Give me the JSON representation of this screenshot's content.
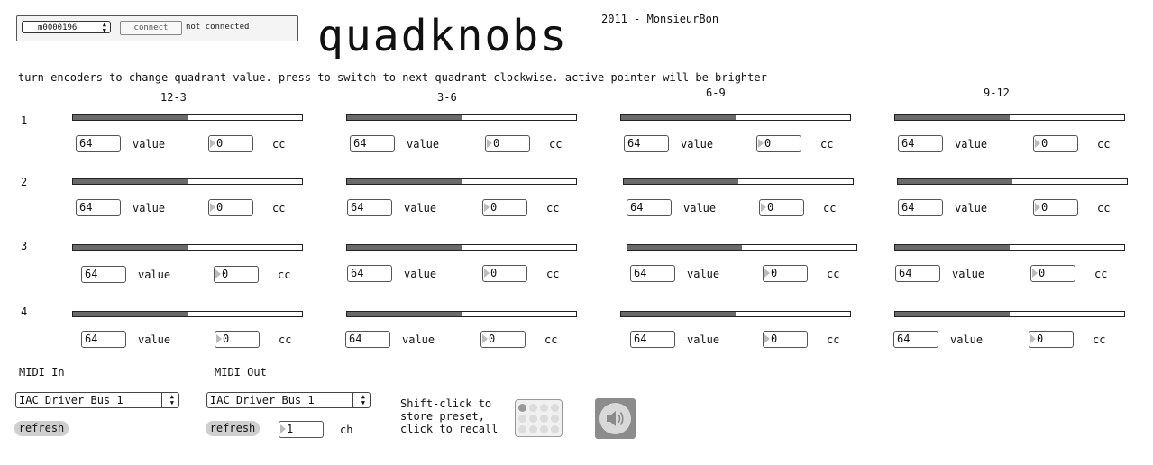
{
  "device": {
    "selected": "m0000196",
    "connect_label": "connect",
    "status": "not connected"
  },
  "title": "quadknobs",
  "credit": "2011 - MonsieurBon",
  "instructions": "turn encoders to change quadrant value. press to switch to next quadrant clockwise. active pointer will be brighter",
  "quadrants": [
    "12-3",
    "3-6",
    "6-9",
    "9-12"
  ],
  "rows": [
    {
      "label": "1",
      "cells": [
        {
          "slider": 0.5,
          "value": "64",
          "value_label": "value",
          "cc": "0",
          "cc_label": "cc"
        },
        {
          "slider": 0.5,
          "value": "64",
          "value_label": "value",
          "cc": "0",
          "cc_label": "cc"
        },
        {
          "slider": 0.5,
          "value": "64",
          "value_label": "value",
          "cc": "0",
          "cc_label": "cc"
        },
        {
          "slider": 0.5,
          "value": "64",
          "value_label": "value",
          "cc": "0",
          "cc_label": "cc"
        }
      ]
    },
    {
      "label": "2",
      "cells": [
        {
          "slider": 0.5,
          "value": "64",
          "value_label": "value",
          "cc": "0",
          "cc_label": "cc"
        },
        {
          "slider": 0.5,
          "value": "64",
          "value_label": "value",
          "cc": "0",
          "cc_label": "cc"
        },
        {
          "slider": 0.5,
          "value": "64",
          "value_label": "value",
          "cc": "0",
          "cc_label": "cc"
        },
        {
          "slider": 0.5,
          "value": "64",
          "value_label": "value",
          "cc": "0",
          "cc_label": "cc"
        }
      ]
    },
    {
      "label": "3",
      "cells": [
        {
          "slider": 0.5,
          "value": "64",
          "value_label": "value",
          "cc": "0",
          "cc_label": "cc"
        },
        {
          "slider": 0.5,
          "value": "64",
          "value_label": "value",
          "cc": "0",
          "cc_label": "cc"
        },
        {
          "slider": 0.5,
          "value": "64",
          "value_label": "value",
          "cc": "0",
          "cc_label": "cc"
        },
        {
          "slider": 0.5,
          "value": "64",
          "value_label": "value",
          "cc": "0",
          "cc_label": "cc"
        }
      ]
    },
    {
      "label": "4",
      "cells": [
        {
          "slider": 0.5,
          "value": "64",
          "value_label": "value",
          "cc": "0",
          "cc_label": "cc"
        },
        {
          "slider": 0.5,
          "value": "64",
          "value_label": "value",
          "cc": "0",
          "cc_label": "cc"
        },
        {
          "slider": 0.5,
          "value": "64",
          "value_label": "value",
          "cc": "0",
          "cc_label": "cc"
        },
        {
          "slider": 0.5,
          "value": "64",
          "value_label": "value",
          "cc": "0",
          "cc_label": "cc"
        }
      ]
    }
  ],
  "midi_in": {
    "label": "MIDI In",
    "selected": "IAC Driver Bus 1",
    "refresh_label": "refresh"
  },
  "midi_out": {
    "label": "MIDI Out",
    "selected": "IAC Driver Bus 1",
    "refresh_label": "refresh",
    "channel": "1",
    "channel_label": "ch"
  },
  "preset": {
    "note_line1": "Shift-click to",
    "note_line2": "store preset,",
    "note_line3": "click to recall",
    "active_slot": 1
  },
  "speaker_icon": "speaker-icon",
  "colors": {
    "slider_fill": "#6a6a6a",
    "button_bg": "#cfcfcf",
    "speaker_bg": "#8c8c8c"
  }
}
